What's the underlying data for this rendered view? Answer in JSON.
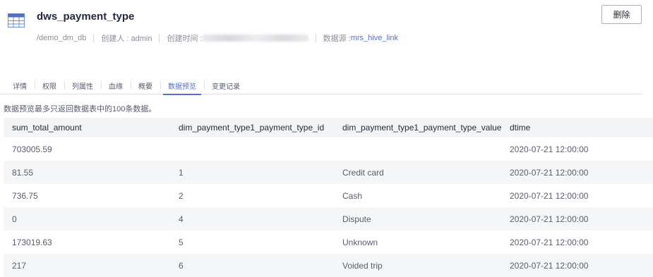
{
  "header": {
    "title": "dws_payment_type",
    "path": "/demo_dm_db",
    "creator_label": "创建人 : admin",
    "created_time_label": "创建时间 :",
    "datasource_label": "数据源 :",
    "datasource_value": "mrs_hive_link",
    "delete_label": "删除"
  },
  "tabs": [
    {
      "label": "详情"
    },
    {
      "label": "权限"
    },
    {
      "label": "列属性"
    },
    {
      "label": "血缘"
    },
    {
      "label": "概要"
    },
    {
      "label": "数据预览",
      "active": true
    },
    {
      "label": "变更记录"
    }
  ],
  "preview_note": "数据预览最多只返回数据表中的100条数据。",
  "table": {
    "columns": [
      "sum_total_amount",
      "dim_payment_type1_payment_type_id",
      "dim_payment_type1_payment_type_value",
      "dtime"
    ],
    "rows": [
      [
        "703005.59",
        "",
        "",
        "2020-07-21 12:00:00"
      ],
      [
        "81.55",
        "1",
        "Credit card",
        "2020-07-21 12:00:00"
      ],
      [
        "736.75",
        "2",
        "Cash",
        "2020-07-21 12:00:00"
      ],
      [
        "0",
        "4",
        "Dispute",
        "2020-07-21 12:00:00"
      ],
      [
        "173019.63",
        "5",
        "Unknown",
        "2020-07-21 12:00:00"
      ],
      [
        "217",
        "6",
        "Voided trip",
        "2020-07-21 12:00:00"
      ]
    ]
  },
  "colors": {
    "accent": "#526ecc",
    "header_bg": "#f3f4f6",
    "stripe_bg": "#f5f6f8"
  }
}
